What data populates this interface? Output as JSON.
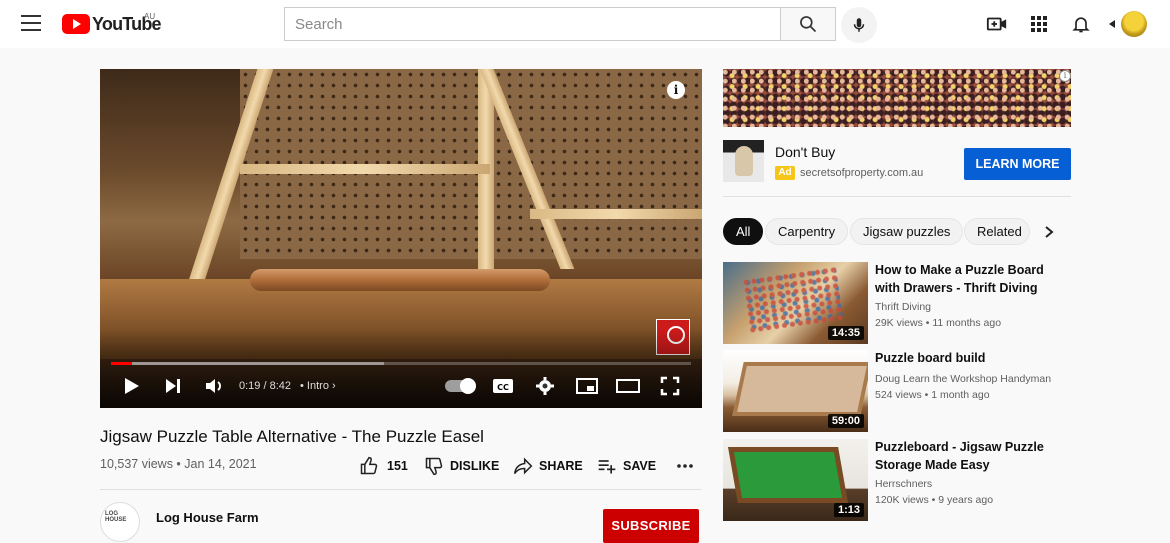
{
  "header": {
    "logo_text": "YouTube",
    "region": "AU",
    "search_placeholder": "Search"
  },
  "player": {
    "time": "0:19 / 8:42",
    "chapter": "Intro",
    "progress_fraction": 0.036,
    "buffer_fraction": 0.47,
    "info_glyph": "i"
  },
  "video": {
    "title": "Jigsaw Puzzle Table Alternative - The Puzzle Easel",
    "meta": "10,537 views • Jan 14, 2021",
    "likes": "151",
    "dislike_label": "DISLIKE",
    "share_label": "SHARE",
    "save_label": "SAVE"
  },
  "channel": {
    "name": "Log House Farm",
    "avatar_text": "LOG HOUSE",
    "subscribe_label": "SUBSCRIBE"
  },
  "ad": {
    "title": "Don't Buy",
    "tag": "Ad",
    "domain": "secretsofproperty.com.au",
    "cta": "LEARN MORE"
  },
  "chips": [
    "All",
    "Carpentry",
    "Jigsaw puzzles",
    "Related"
  ],
  "recommendations": [
    {
      "title": "How to Make a Puzzle Board with Drawers - Thrift Diving",
      "channel": "Thrift Diving",
      "stats": "29K views • 11 months ago",
      "duration": "14:35"
    },
    {
      "title": "Puzzle board build",
      "channel": "Doug Learn the Workshop Handyman",
      "stats": "524 views • 1 month ago",
      "duration": "59:00"
    },
    {
      "title": "Puzzleboard - Jigsaw Puzzle Storage Made Easy",
      "channel": "Herrschners",
      "stats": "120K views • 9 years ago",
      "duration": "1:13"
    }
  ],
  "colors": {
    "brand_red": "#ff0000",
    "progress_red": "#ff0000",
    "subscribe_red": "#cc0000",
    "cta_blue": "#065fd4",
    "ad_yellow": "#f5c518"
  }
}
